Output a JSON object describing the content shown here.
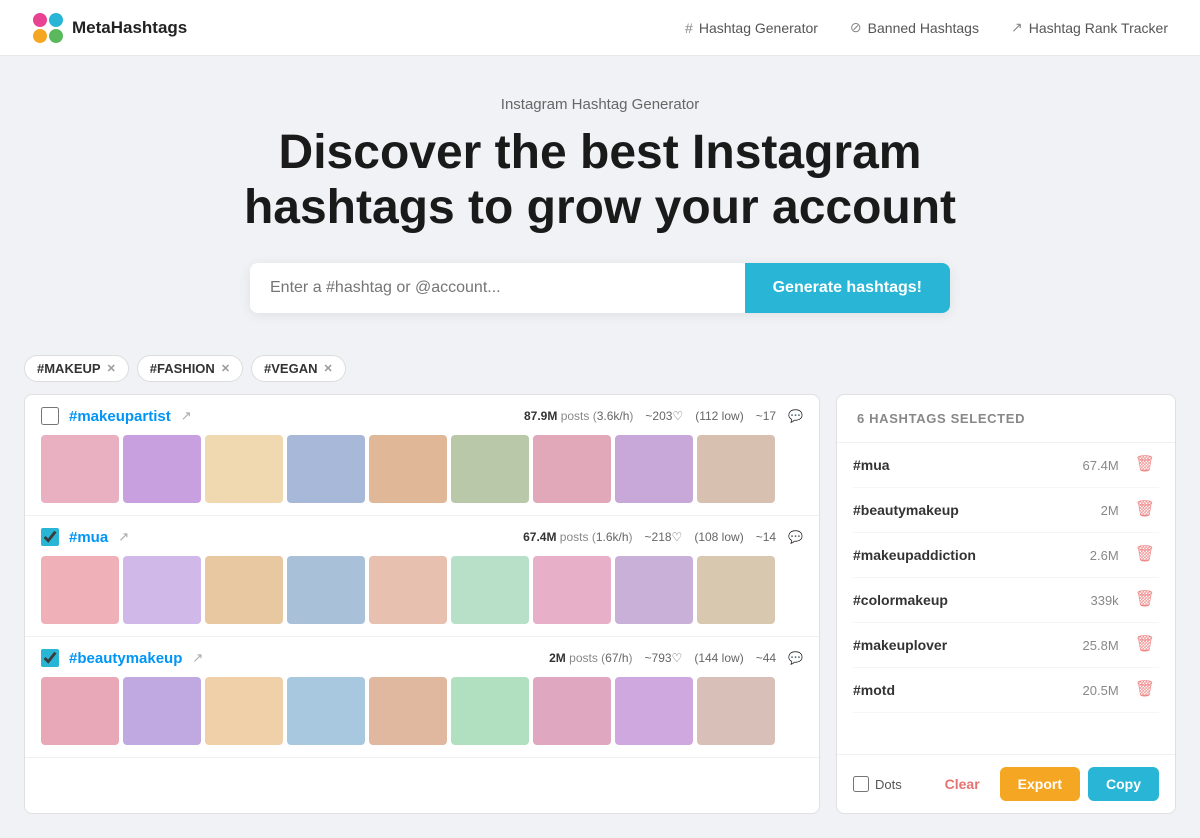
{
  "app": {
    "logo_text": "MetaHashtags",
    "title": "Instagram Hashtag Generator",
    "hero_title_line1": "Discover the best Instagram",
    "hero_title_line2": "hashtags to grow your account"
  },
  "nav": {
    "items": [
      {
        "id": "hashtag-generator",
        "icon": "#",
        "label": "Hashtag Generator"
      },
      {
        "id": "banned-hashtags",
        "icon": "⊘",
        "label": "Banned Hashtags"
      },
      {
        "id": "rank-tracker",
        "icon": "↗",
        "label": "Hashtag Rank Tracker"
      }
    ]
  },
  "search": {
    "placeholder": "Enter a #hashtag or @account...",
    "button_label": "Generate hashtags!"
  },
  "filter_tags": [
    {
      "id": "makeup",
      "label": "#MAKEUP"
    },
    {
      "id": "fashion",
      "label": "#FASHION"
    },
    {
      "id": "vegan",
      "label": "#VEGAN"
    }
  ],
  "hashtag_rows": [
    {
      "id": "makeupartist",
      "name": "#makeupartist",
      "checked": false,
      "posts": "87.9M",
      "posts_rate": "3.6k/h",
      "likes": "~203",
      "comments_low": "112 low",
      "tags": "~17"
    },
    {
      "id": "mua",
      "name": "#mua",
      "checked": true,
      "posts": "67.4M",
      "posts_rate": "1.6k/h",
      "likes": "~218",
      "comments_low": "108 low",
      "tags": "~14"
    },
    {
      "id": "beautymakeup",
      "name": "#beautymakeup",
      "checked": true,
      "posts": "2M",
      "posts_rate": "67/h",
      "likes": "~793",
      "comments_low": "144 low",
      "tags": "~44"
    }
  ],
  "right_panel": {
    "header": "6 HASHTAGS SELECTED",
    "selected_items": [
      {
        "id": "mua",
        "name": "#mua",
        "count": "67.4M"
      },
      {
        "id": "beautymakeup",
        "name": "#beautymakeup",
        "count": "2M"
      },
      {
        "id": "makeupaddiction",
        "name": "#makeupaddiction",
        "count": "2.6M"
      },
      {
        "id": "colormakeup",
        "name": "#colormakeup",
        "count": "339k"
      },
      {
        "id": "makeuplover",
        "name": "#makeuplover",
        "count": "25.8M"
      },
      {
        "id": "motd",
        "name": "#motd",
        "count": "20.5M"
      }
    ],
    "dots_label": "Dots",
    "clear_label": "Clear",
    "export_label": "Export",
    "copy_label": "Copy"
  }
}
